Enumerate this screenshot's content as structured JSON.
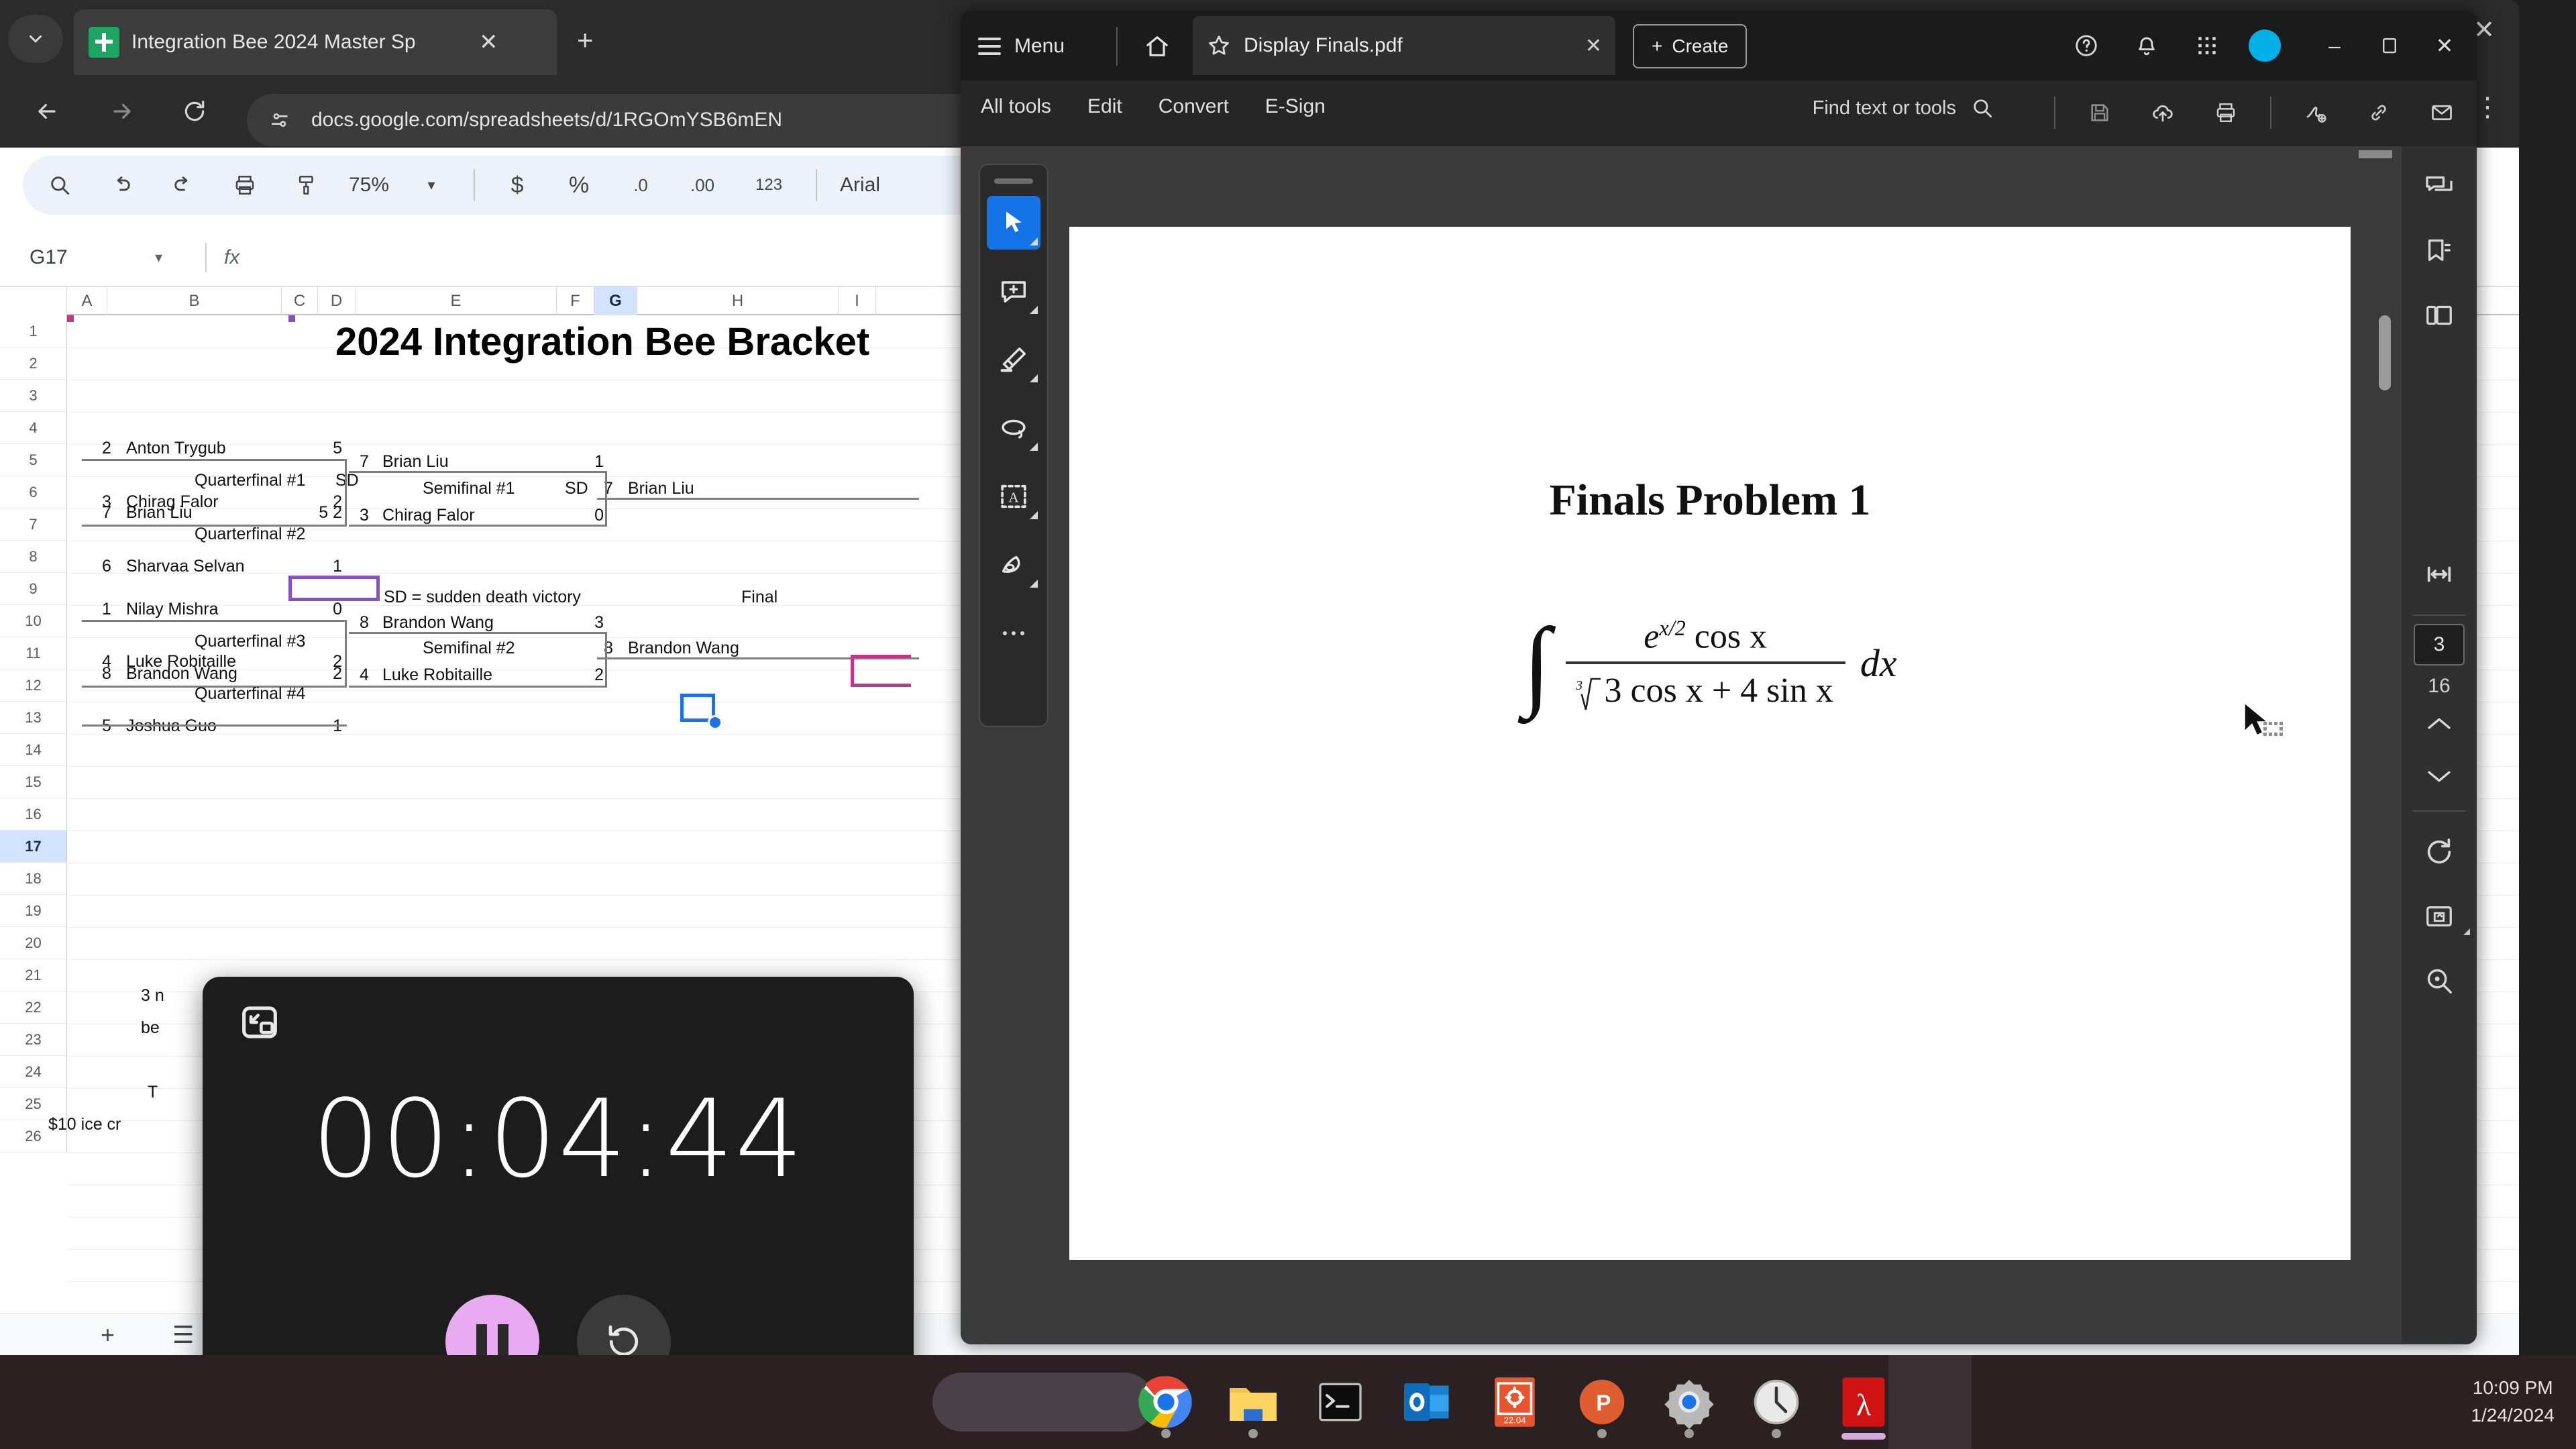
{
  "browser": {
    "tab_title": "Integration Bee 2024 Master Sp",
    "url": "docs.google.com/spreadsheets/d/1RGOmYSB6mEN",
    "new_tab_label": "+",
    "tab_close_label": "✕",
    "window_close_label": "✕",
    "menu_label": "⋮"
  },
  "sheets": {
    "toolbar": {
      "zoom": "75%",
      "currency": "$",
      "percent": "%",
      "decrease_decimal": ".0",
      "increase_decimal": ".00",
      "number_format": "123",
      "font": "Arial"
    },
    "name_box": "G17",
    "name_box_caret": "▾",
    "fx_label": "fx",
    "columns": [
      "A",
      "B",
      "C",
      "D",
      "E",
      "F",
      "G",
      "H",
      "I"
    ],
    "selected_column": "G",
    "rows": [
      1,
      2,
      3,
      4,
      5,
      6,
      7,
      8,
      9,
      10,
      11,
      12,
      13,
      14,
      15,
      16,
      17,
      18,
      19,
      20,
      21,
      22,
      23,
      24,
      25,
      26
    ],
    "selected_row": 17,
    "bottom_bar": {
      "add_sheet": "+",
      "all_sheets": "☰"
    }
  },
  "bracket": {
    "title": "2024 Integration Bee Bracket",
    "legend": "SD = sudden death victory",
    "final_label": "Final",
    "quarterfinals": [
      {
        "label": "Quarterfinal #1",
        "sd": "SD",
        "top": {
          "seed": "2",
          "name": "Anton Trygub",
          "score": "5"
        },
        "bottom": {
          "seed": "7",
          "name": "Brian Liu",
          "score": "5 2"
        }
      },
      {
        "label": "Quarterfinal #2",
        "sd": "",
        "top": {
          "seed": "3",
          "name": "Chirag Falor",
          "score": "2"
        },
        "bottom": {
          "seed": "6",
          "name": "Sharvaa Selvan",
          "score": "1"
        }
      },
      {
        "label": "Quarterfinal #3",
        "sd": "",
        "top": {
          "seed": "1",
          "name": "Nilay Mishra",
          "score": "0"
        },
        "bottom": {
          "seed": "8",
          "name": "Brandon Wang",
          "score": "2"
        }
      },
      {
        "label": "Quarterfinal #4",
        "sd": "",
        "top": {
          "seed": "4",
          "name": "Luke Robitaille",
          "score": "2"
        },
        "bottom": {
          "seed": "5",
          "name": "Joshua Guo",
          "score": "1"
        }
      }
    ],
    "semifinals": [
      {
        "label": "Semifinal #1",
        "sd": "SD",
        "top": {
          "seed": "7",
          "name": "Brian Liu",
          "score": "1"
        },
        "bottom": {
          "seed": "3",
          "name": "Chirag Falor",
          "score": "0"
        },
        "winner": {
          "seed": "7",
          "name": "Brian Liu"
        }
      },
      {
        "label": "Semifinal #2",
        "sd": "",
        "top": {
          "seed": "8",
          "name": "Brandon Wang",
          "score": "3"
        },
        "bottom": {
          "seed": "4",
          "name": "Luke Robitaille",
          "score": "2"
        },
        "winner": {
          "seed": "8",
          "name": "Brandon Wang"
        }
      }
    ],
    "notes": [
      {
        "row": 19,
        "text": "3 n"
      },
      {
        "row": 20,
        "text": "be"
      },
      {
        "row": 22,
        "text": "T"
      },
      {
        "row": 23,
        "text": "$10 ice cr"
      }
    ],
    "colors": {
      "final_cell_purple": "#8a4ec7",
      "finalist_cell_magenta": "#c2368a",
      "active_cell_blue": "#1a73e8"
    }
  },
  "acrobat": {
    "menu_label": "Menu",
    "document_tab": "Display Finals.pdf",
    "tab_close": "✕",
    "create_label": "Create",
    "create_plus": "+",
    "tools": [
      "All tools",
      "Edit",
      "Convert",
      "E-Sign"
    ],
    "find_label": "Find text or tools",
    "window_buttons": {
      "minimize": "–",
      "maximize": "▭",
      "close": "✕"
    },
    "page_current": "3",
    "page_total": "16",
    "page_up": "⌃",
    "page_down": "⌄",
    "left_tools": [
      "select-tool",
      "add-comment-tool",
      "highlight-tool",
      "draw-oval-tool",
      "add-text-tool",
      "stamp-tool",
      "more-tools"
    ],
    "right_tools": [
      "comment-panel",
      "bookmarks-panel",
      "page-thumbnails-panel",
      "fit-width",
      "rotate",
      "page-organize",
      "zoom-tool"
    ],
    "pdf": {
      "title": "Finals Problem 1",
      "integral_sign": "∫",
      "numerator_e": "e",
      "numerator_exp": "x/2",
      "numerator_cos": "cos x",
      "denominator_root_index": "3",
      "denominator": "3 cos x + 4 sin x",
      "differential": "dx",
      "expression_text": "∫ (e^(x/2) cos x) / (∛(3 cos x + 4 sin x)) dx"
    }
  },
  "timer": {
    "display": "00:04:44",
    "pause_label": "pause-button",
    "reset_label": "reset-button",
    "pip_label": "picture-in-picture-icon"
  },
  "taskbar": {
    "items": [
      "google-chrome",
      "file-explorer",
      "terminal",
      "outlook",
      "calendar-22-04",
      "powerpoint",
      "settings",
      "clock",
      "adobe-acrobat"
    ],
    "calendar_day": "22:04",
    "clock_time": "10:09 PM",
    "clock_date": "1/24/2024"
  }
}
